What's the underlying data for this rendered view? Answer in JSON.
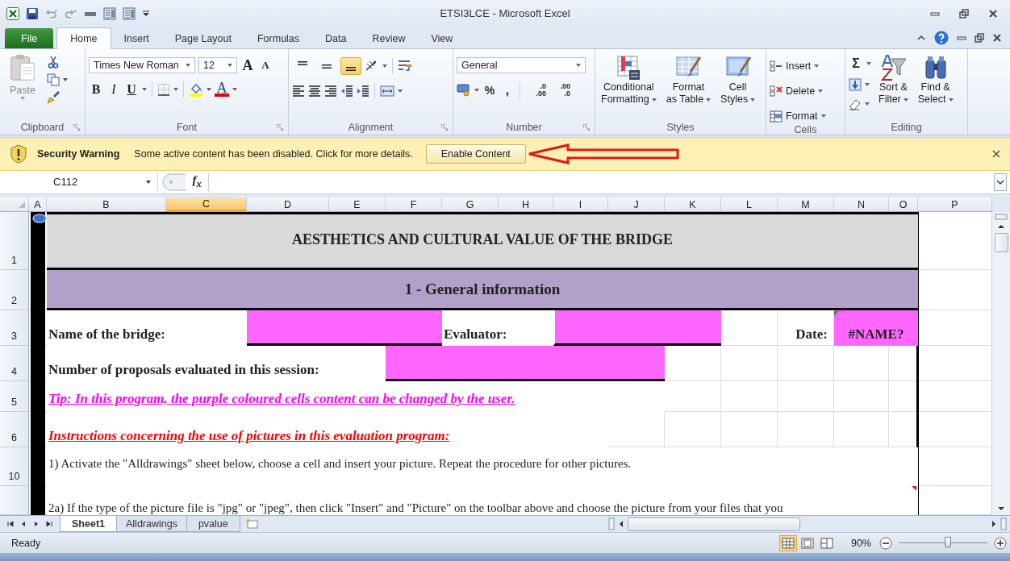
{
  "window": {
    "title": "ETSI3LCE  -  Microsoft Excel"
  },
  "ribbon_tabs": [
    {
      "label": "File",
      "kind": "file",
      "selected": false
    },
    {
      "label": "Home",
      "kind": "tab",
      "selected": true
    },
    {
      "label": "Insert",
      "kind": "tab",
      "selected": false
    },
    {
      "label": "Page Layout",
      "kind": "tab",
      "selected": false
    },
    {
      "label": "Formulas",
      "kind": "tab",
      "selected": false
    },
    {
      "label": "Data",
      "kind": "tab",
      "selected": false
    },
    {
      "label": "Review",
      "kind": "tab",
      "selected": false
    },
    {
      "label": "View",
      "kind": "tab",
      "selected": false
    }
  ],
  "ribbon": {
    "clipboard": {
      "label": "Clipboard",
      "paste": "Paste"
    },
    "font": {
      "label": "Font",
      "font_name": "Times New Roman",
      "font_size": "12",
      "grow": "A",
      "shrink": "A",
      "bold": "B",
      "italic": "I",
      "underline": "U",
      "font_color": "A"
    },
    "alignment": {
      "label": "Alignment",
      "vertical": [
        {
          "selected": false
        },
        {
          "selected": false
        },
        {
          "selected": true
        }
      ]
    },
    "number": {
      "label": "Number",
      "format": "General",
      "percent": "%",
      "comma": ",",
      "increase_decimal": [
        ".0",
        ".00"
      ],
      "decrease_decimal": [
        ".00",
        ".0"
      ]
    },
    "styles": {
      "label": "Styles",
      "buttons": [
        {
          "lines": [
            "Conditional",
            "Formatting"
          ]
        },
        {
          "lines": [
            "Format",
            "as Table"
          ]
        },
        {
          "lines": [
            "Cell",
            "Styles"
          ]
        }
      ]
    },
    "cells": {
      "label": "Cells",
      "buttons": [
        "Insert",
        "Delete",
        "Format"
      ]
    },
    "editing": {
      "label": "Editing",
      "sum": "Σ",
      "buttons": [
        {
          "lines": [
            "Sort &",
            "Filter"
          ]
        },
        {
          "lines": [
            "Find &",
            "Select"
          ]
        }
      ]
    }
  },
  "security_bar": {
    "title": "Security Warning",
    "message": "Some active content has been disabled. Click for more details.",
    "button": "Enable Content"
  },
  "formula_bar": {
    "name_box": "C112",
    "fx": "f$_{x}$"
  },
  "columns": [
    {
      "label": "A",
      "selected": false
    },
    {
      "label": "B",
      "selected": false
    },
    {
      "label": "C",
      "selected": true
    },
    {
      "label": "D",
      "selected": false
    },
    {
      "label": "E",
      "selected": false
    },
    {
      "label": "F",
      "selected": false
    },
    {
      "label": "G",
      "selected": false
    },
    {
      "label": "H",
      "selected": false
    },
    {
      "label": "I",
      "selected": false
    },
    {
      "label": "J",
      "selected": false
    },
    {
      "label": "K",
      "selected": false
    },
    {
      "label": "L",
      "selected": false
    },
    {
      "label": "M",
      "selected": false
    },
    {
      "label": "N",
      "selected": false
    },
    {
      "label": "O",
      "selected": false
    },
    {
      "label": "P",
      "selected": false
    }
  ],
  "rows": [
    "1",
    "2",
    "3",
    "4",
    "5",
    "6",
    "10"
  ],
  "sheet": {
    "title": "AESTHETICS AND CULTURAL VALUE OF THE BRIDGE",
    "section": "1 - General information",
    "name_label": "Name of the bridge:",
    "evaluator_label": "Evaluator:",
    "date_label": "Date:",
    "date_value": "#NAME?",
    "proposals_label": "Number of proposals evaluated in this session:",
    "tip": "Tip: In this program, the purple coloured cells content can be changed by the user.",
    "instructions_heading": "Instructions concerning the use of pictures in this evaluation program:",
    "instruction_1": "1) Activate the \"Alldrawings\" sheet below, choose a cell and insert your picture. Repeat the procedure for other pictures.",
    "instruction_2a": "2a) If the type of the picture file is \"jpg\" or \"jpeg\", then  click \"Insert\" and \"Picture\" on the toolbar above and choose the picture from your files that you"
  },
  "sheet_tabs": [
    {
      "label": "Sheet1",
      "selected": true
    },
    {
      "label": "Alldrawings",
      "selected": false
    },
    {
      "label": "pvalue",
      "selected": false
    }
  ],
  "status_bar": {
    "mode": "Ready",
    "zoom": "90%",
    "zoom_slider": {
      "level": 0.55
    }
  }
}
